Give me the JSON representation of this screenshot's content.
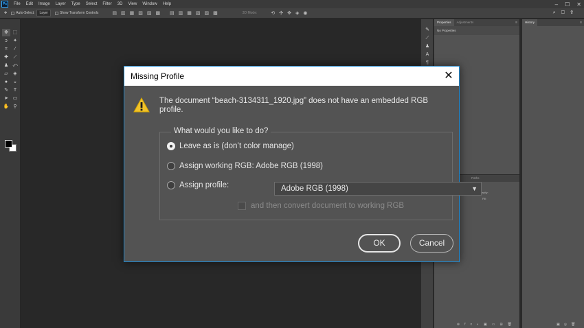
{
  "app": {
    "logo": "Ps",
    "menu": [
      "File",
      "Edit",
      "Image",
      "Layer",
      "Type",
      "Select",
      "Filter",
      "3D",
      "View",
      "Window",
      "Help"
    ],
    "window_controls": [
      "–",
      "☐",
      "✕"
    ]
  },
  "options_bar": {
    "auto_select_label": "Auto-Select:",
    "auto_select_value": "Layer",
    "transform_label": "Show Transform Controls",
    "mode_3d_label": "3D Mode:"
  },
  "tools": [
    "move",
    "marquee",
    "lasso",
    "magic-wand",
    "crop",
    "eyedropper",
    "healing-brush",
    "brush",
    "clone-stamp",
    "history-brush",
    "eraser",
    "paint-bucket",
    "blur",
    "dodge",
    "pen",
    "type",
    "path-select",
    "rectangle",
    "hand",
    "zoom"
  ],
  "colors": {
    "foreground": "#000000",
    "background": "#ffffff",
    "accent": "#1f8ad2",
    "warning": "#f0c22a"
  },
  "panels": {
    "properties_tab": "Properties",
    "adjustments_tab": "Adjustments",
    "no_properties": "No Properties",
    "history_tab": "History",
    "paths_tab": "Paths",
    "opacity_label": "Opacity:",
    "fill_label": "Fill:"
  },
  "dialog": {
    "title": "Missing Profile",
    "message": "The document “beach-3134311_1920.jpg” does not have an embedded RGB profile.",
    "group_label": "What would you like to do?",
    "options": [
      {
        "label": "Leave as is (don’t color manage)",
        "checked": true
      },
      {
        "label": "Assign working RGB:  Adobe RGB (1998)",
        "checked": false
      },
      {
        "label": "Assign profile:",
        "checked": false
      }
    ],
    "profile_select_value": "Adobe RGB (1998)",
    "convert_label": "and then convert document to working RGB",
    "ok_label": "OK",
    "cancel_label": "Cancel"
  }
}
